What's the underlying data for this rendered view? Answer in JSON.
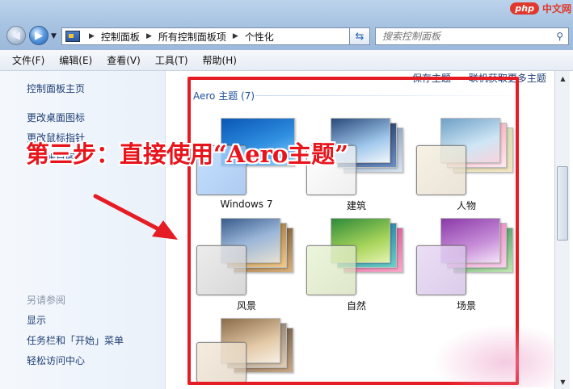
{
  "window": {
    "watermark": {
      "badge": "php",
      "text": "中文网"
    }
  },
  "address_bar": {
    "breadcrumbs": [
      "控制面板",
      "所有控制面板项",
      "个性化"
    ],
    "search_placeholder": "搜索控制面板"
  },
  "menu": [
    "文件(F)",
    "编辑(E)",
    "查看(V)",
    "工具(T)",
    "帮助(H)"
  ],
  "sidebar": {
    "links": [
      "控制面板主页",
      "更改桌面图标",
      "更改鼠标指针",
      "更改帐户图片"
    ],
    "see_also_heading": "另请参阅",
    "see_also": [
      "显示",
      "任务栏和「开始」菜单",
      "轻松访问中心"
    ]
  },
  "main": {
    "top_links": [
      "保存主题",
      "联机获取更多主题"
    ],
    "section_title": "Aero 主题 (7)",
    "themes": [
      {
        "name": "Windows 7",
        "colors": [
          "#1d7fd6",
          "#58b7f2"
        ]
      },
      {
        "name": "建筑",
        "colors": [
          "#2a4a7a",
          "#9fc7ec"
        ]
      },
      {
        "name": "人物",
        "colors": [
          "#6ea0c7",
          "#f3a5b2"
        ]
      },
      {
        "name": "风景",
        "colors": [
          "#3a5c8c",
          "#e7e0d2"
        ]
      },
      {
        "name": "自然",
        "colors": [
          "#2f8a3a",
          "#a7d45a"
        ]
      },
      {
        "name": "场景",
        "colors": [
          "#8a3aa8",
          "#c78ed8"
        ]
      },
      {
        "name": "",
        "colors": [
          "#8a6a4a",
          "#e3c9a6"
        ]
      }
    ]
  },
  "annotation": {
    "text": "第三步：直接使用“Aero主题”",
    "color": "#e51c23"
  }
}
